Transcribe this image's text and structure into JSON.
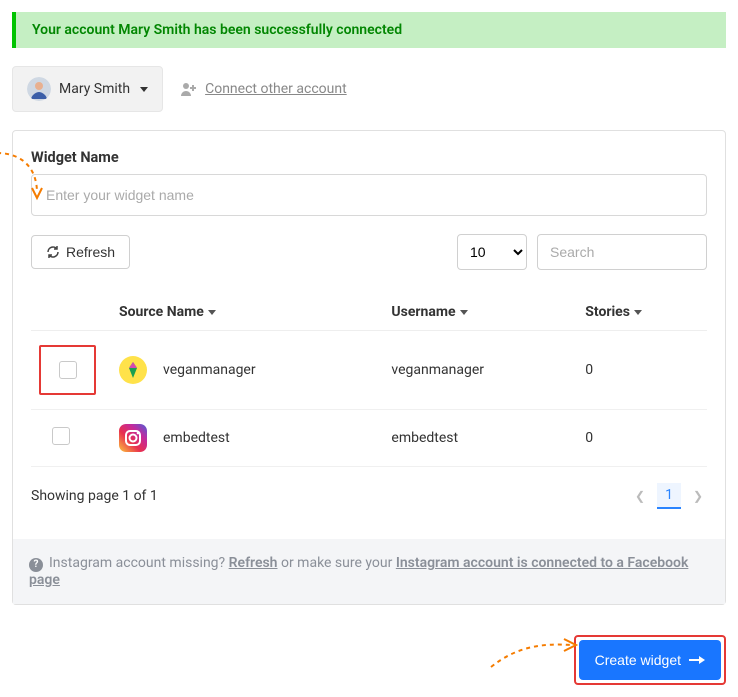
{
  "alert": {
    "text": "Your account Mary Smith has been successfully connected"
  },
  "account": {
    "name": "Mary Smith",
    "connect_label": "Connect other account"
  },
  "widget": {
    "name_label": "Widget Name",
    "name_placeholder": "Enter your widget name",
    "refresh_label": "Refresh",
    "page_size": "10",
    "search_placeholder": "Search"
  },
  "table": {
    "headers": {
      "source": "Source Name",
      "username": "Username",
      "stories": "Stories"
    },
    "rows": [
      {
        "source": "veganmanager",
        "username": "veganmanager",
        "stories": "0"
      },
      {
        "source": "embedtest",
        "username": "embedtest",
        "stories": "0"
      }
    ]
  },
  "pager": {
    "summary": "Showing page 1 of 1",
    "current": "1"
  },
  "hint": {
    "text_a": "Instagram account missing? ",
    "refresh": "Refresh",
    "text_b": " or make sure your ",
    "link": "Instagram account is connected to a Facebook page"
  },
  "footer": {
    "create_label": "Create widget"
  }
}
